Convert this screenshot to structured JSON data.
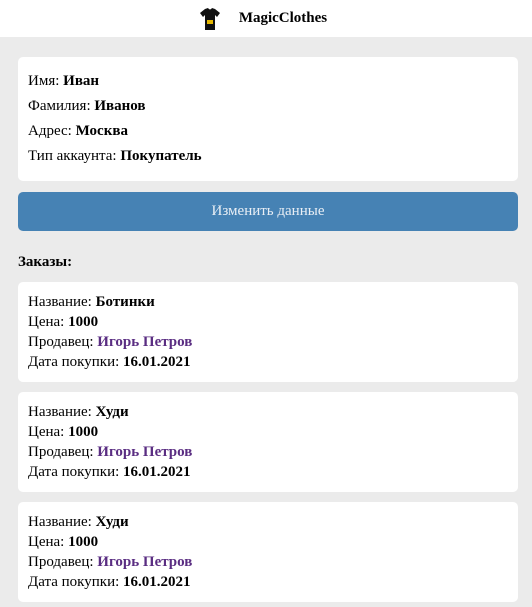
{
  "header": {
    "brand": "MagicClothes",
    "logo_icon": "tshirt-icon"
  },
  "profile": {
    "first_name_label": "Имя:",
    "first_name": "Иван",
    "last_name_label": "Фамилия:",
    "last_name": "Иванов",
    "address_label": "Адрес:",
    "address": "Москва",
    "account_type_label": "Тип аккаунта:",
    "account_type": "Покупатель"
  },
  "edit_button_label": "Изменить данные",
  "orders_title": "Заказы:",
  "order_labels": {
    "name": "Название:",
    "price": "Цена:",
    "seller": "Продавец:",
    "date": "Дата покупки:"
  },
  "orders": [
    {
      "name": "Ботинки",
      "price": "1000",
      "seller": "Игорь Петров",
      "date": "16.01.2021"
    },
    {
      "name": "Худи",
      "price": "1000",
      "seller": "Игорь Петров",
      "date": "16.01.2021"
    },
    {
      "name": "Худи",
      "price": "1000",
      "seller": "Игорь Петров",
      "date": "16.01.2021"
    }
  ],
  "colors": {
    "button": "#4682b4",
    "seller_link": "#5a2d82",
    "background": "#ebebeb"
  }
}
